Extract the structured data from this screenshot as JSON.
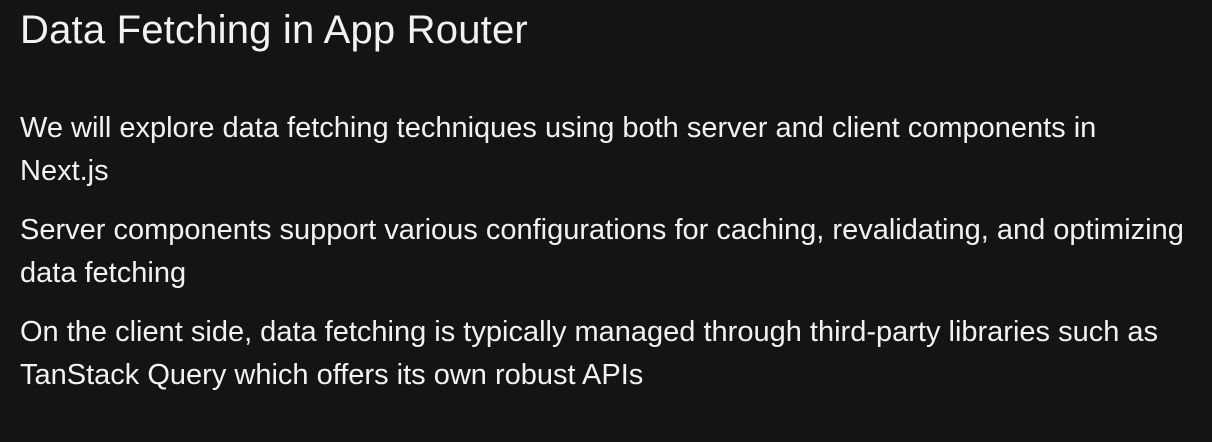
{
  "slide": {
    "title": "Data Fetching in App Router",
    "paragraphs": [
      "We will explore data fetching techniques using both server and client components in Next.js",
      "Server components support various configurations for caching, revalidating, and optimizing data fetching",
      "On the client side, data fetching is typically managed through third-party libraries such as TanStack Query which offers its own robust APIs"
    ]
  },
  "colors": {
    "background": "#141414",
    "text": "#f2f2f2"
  }
}
